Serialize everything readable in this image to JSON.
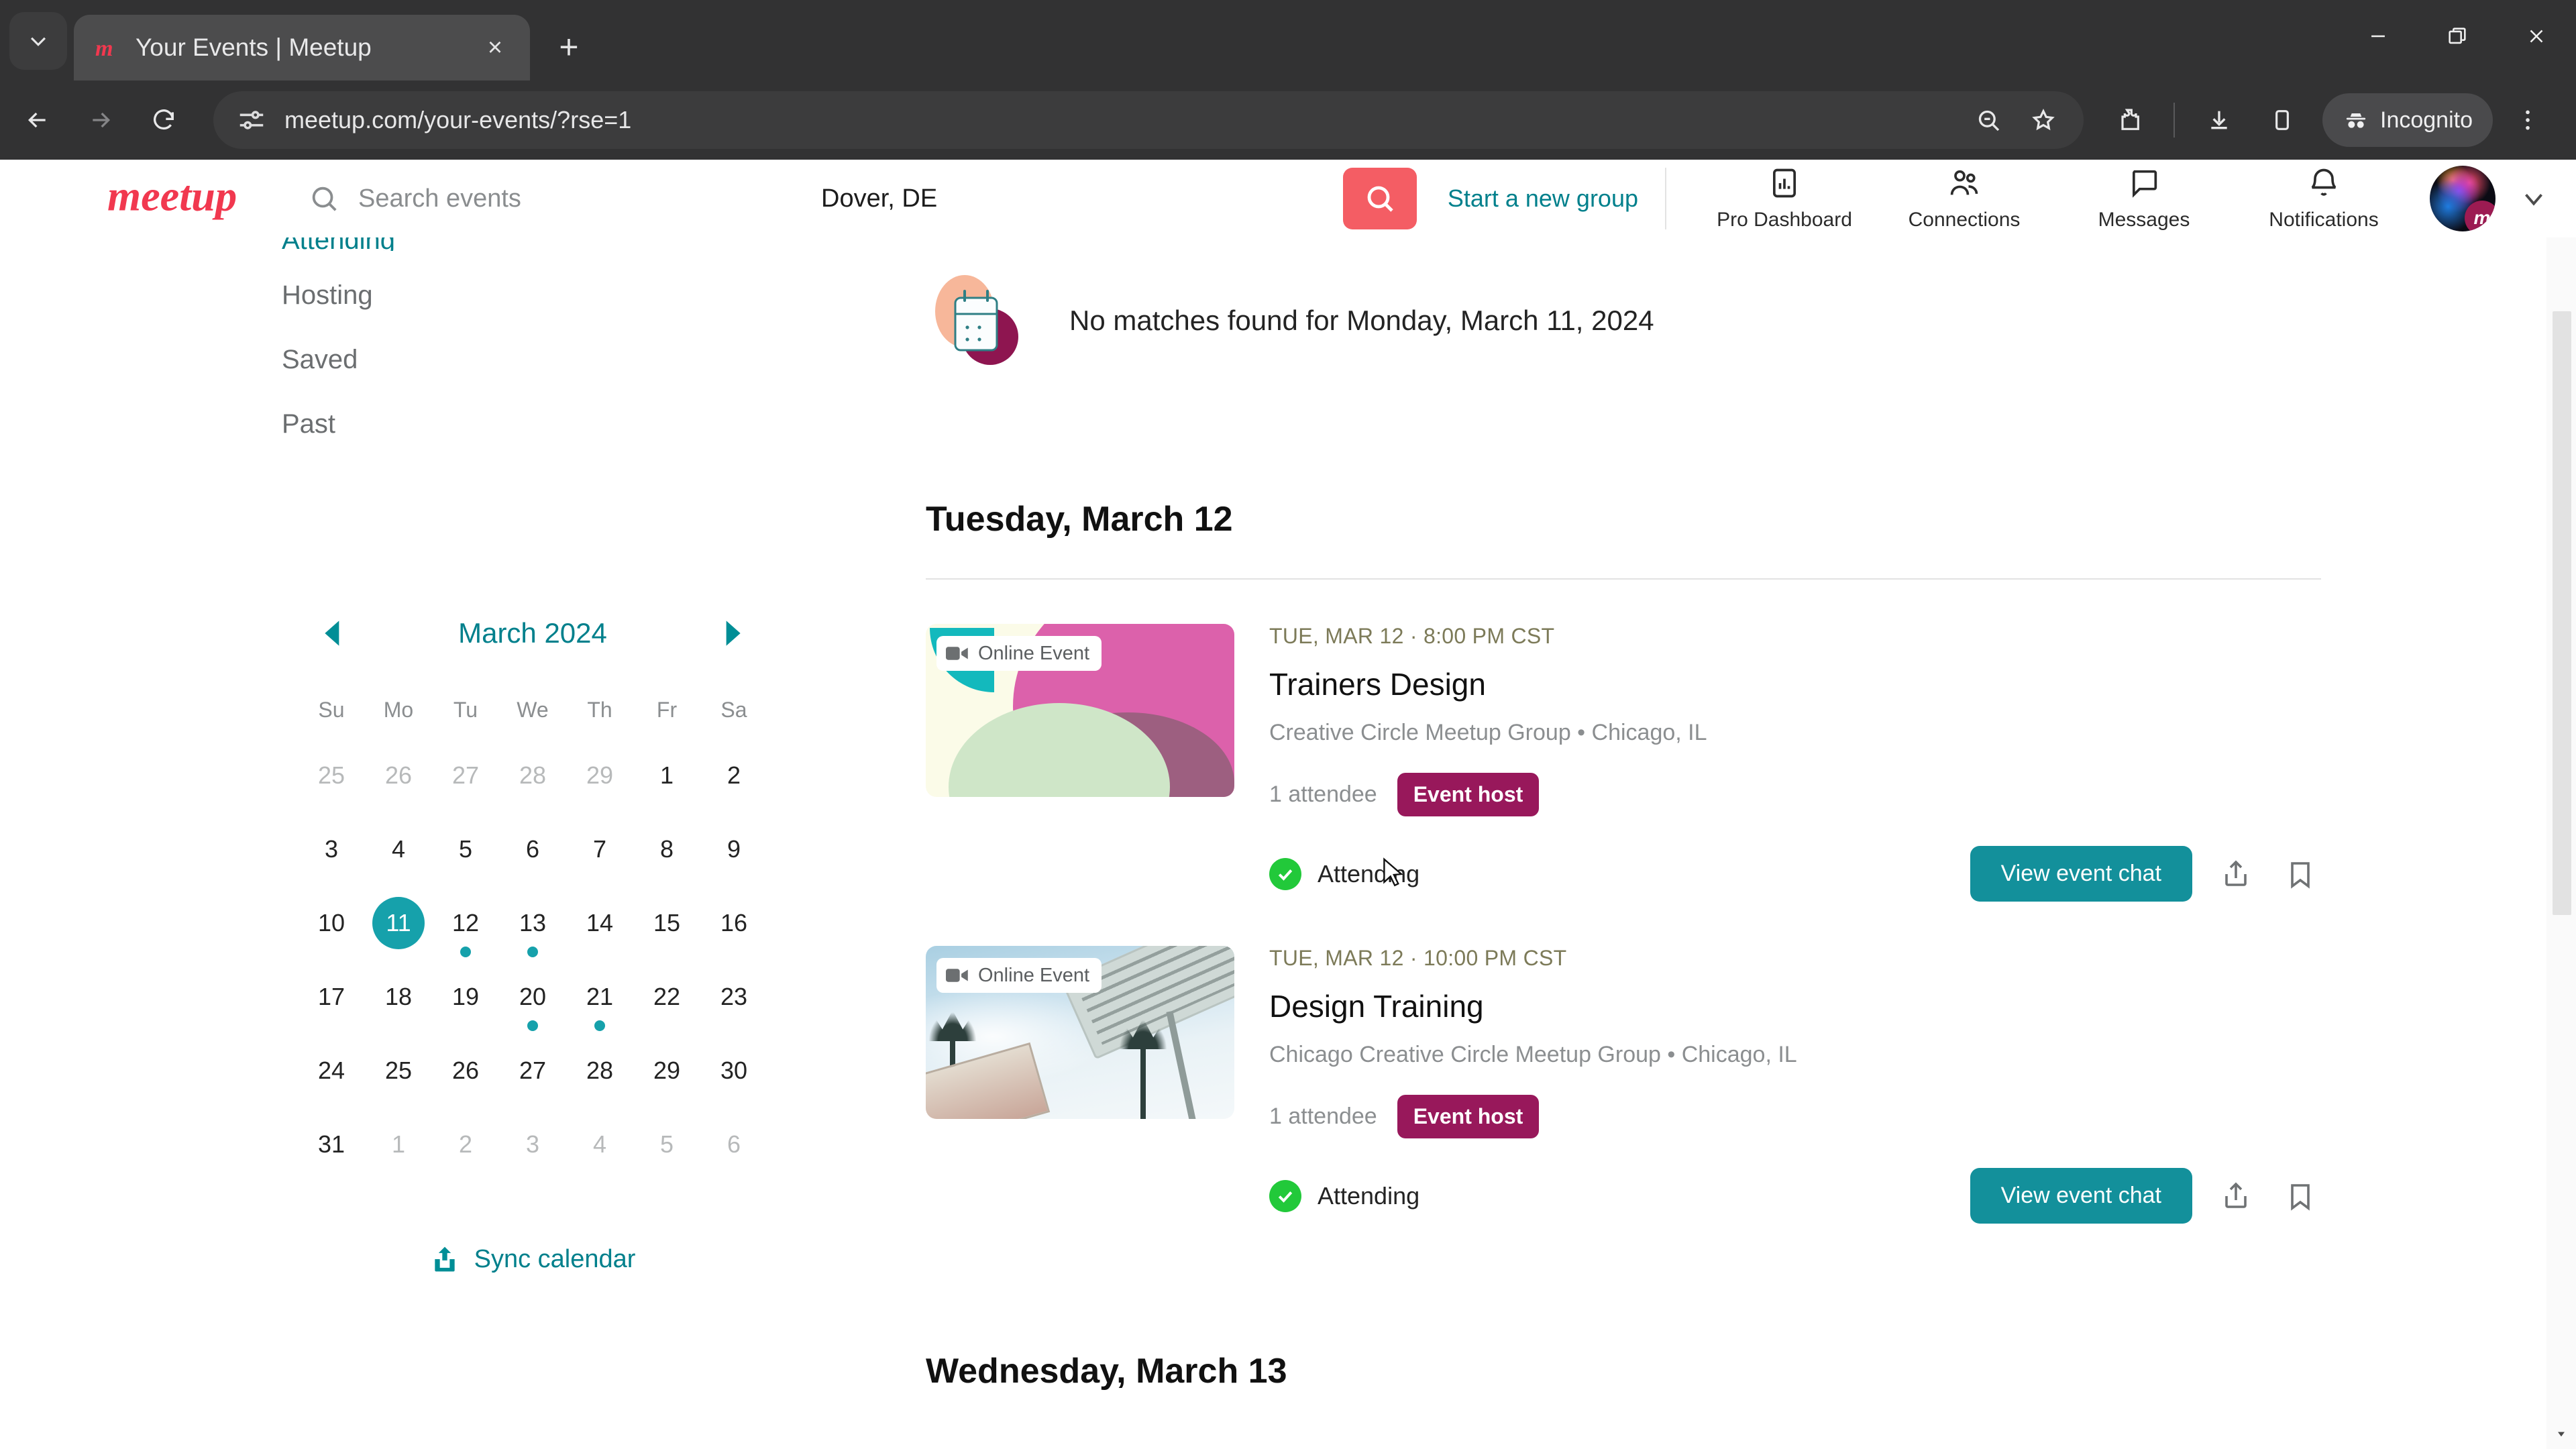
{
  "browser": {
    "tab": {
      "title": "Your Events | Meetup",
      "favicon": "meetup-m-icon",
      "close": "×"
    },
    "new_tab_label": "+",
    "omnibox": {
      "url": "meetup.com/your-events/?rse=1",
      "lead_icon": "page-settings-icon"
    },
    "toolbar_icons": [
      "back-icon",
      "forward-icon",
      "reload-icon",
      "zoom-icon",
      "bookmark-star-icon",
      "extensions-icon",
      "downloads-icon",
      "side-panel-icon",
      "more-menu-icon"
    ],
    "incognito_label": "Incognito",
    "window_controls": [
      "minimize",
      "maximize",
      "close"
    ]
  },
  "header": {
    "logo_text": "meetup",
    "search": {
      "placeholder": "Search events",
      "value": ""
    },
    "location": {
      "value": "Dover, DE",
      "placeholder": "Location"
    },
    "search_button": "search-icon",
    "start_group_link": "Start a new group",
    "nav": [
      {
        "label": "Pro Dashboard",
        "icon": "pro-dashboard-icon"
      },
      {
        "label": "Connections",
        "icon": "connections-icon"
      },
      {
        "label": "Messages",
        "icon": "messages-icon"
      },
      {
        "label": "Notifications",
        "icon": "notifications-bell-icon"
      }
    ],
    "avatar_badge": "m"
  },
  "sidebar": {
    "items": [
      {
        "label": "Attending",
        "active": true
      },
      {
        "label": "Hosting",
        "active": false
      },
      {
        "label": "Saved",
        "active": false
      },
      {
        "label": "Past",
        "active": false
      }
    ],
    "sync_calendar_label": "Sync calendar"
  },
  "calendar": {
    "title": "March 2024",
    "prev_icon": "chevron-left-icon",
    "next_icon": "chevron-right-icon",
    "dow": [
      "Su",
      "Mo",
      "Tu",
      "We",
      "Th",
      "Fr",
      "Sa"
    ],
    "selected_day": 11,
    "event_days": [
      12,
      13,
      20,
      21
    ],
    "weeks": [
      [
        {
          "d": 25,
          "muted": true
        },
        {
          "d": 26,
          "muted": true
        },
        {
          "d": 27,
          "muted": true
        },
        {
          "d": 28,
          "muted": true
        },
        {
          "d": 29,
          "muted": true
        },
        {
          "d": 1,
          "muted": false
        },
        {
          "d": 2,
          "muted": false
        }
      ],
      [
        {
          "d": 3,
          "muted": false
        },
        {
          "d": 4,
          "muted": false
        },
        {
          "d": 5,
          "muted": false
        },
        {
          "d": 6,
          "muted": false
        },
        {
          "d": 7,
          "muted": false
        },
        {
          "d": 8,
          "muted": false
        },
        {
          "d": 9,
          "muted": false
        }
      ],
      [
        {
          "d": 10,
          "muted": false
        },
        {
          "d": 11,
          "muted": false,
          "selected": true
        },
        {
          "d": 12,
          "muted": false,
          "dot": true
        },
        {
          "d": 13,
          "muted": false,
          "dot": true
        },
        {
          "d": 14,
          "muted": false
        },
        {
          "d": 15,
          "muted": false
        },
        {
          "d": 16,
          "muted": false
        }
      ],
      [
        {
          "d": 17,
          "muted": false
        },
        {
          "d": 18,
          "muted": false
        },
        {
          "d": 19,
          "muted": false
        },
        {
          "d": 20,
          "muted": false,
          "dot": true
        },
        {
          "d": 21,
          "muted": false,
          "dot": true
        },
        {
          "d": 22,
          "muted": false
        },
        {
          "d": 23,
          "muted": false
        }
      ],
      [
        {
          "d": 24,
          "muted": false
        },
        {
          "d": 25,
          "muted": false
        },
        {
          "d": 26,
          "muted": false
        },
        {
          "d": 27,
          "muted": false
        },
        {
          "d": 28,
          "muted": false
        },
        {
          "d": 29,
          "muted": false
        },
        {
          "d": 30,
          "muted": false
        }
      ],
      [
        {
          "d": 31,
          "muted": false
        },
        {
          "d": 1,
          "muted": true
        },
        {
          "d": 2,
          "muted": true
        },
        {
          "d": 3,
          "muted": true
        },
        {
          "d": 4,
          "muted": true
        },
        {
          "d": 5,
          "muted": true
        },
        {
          "d": 6,
          "muted": true
        }
      ]
    ]
  },
  "main": {
    "empty_state": {
      "text": "No matches found for Monday, March 11, 2024",
      "icon": "calendar-empty-illustration"
    },
    "day_heading": "Tuesday, March 12",
    "next_day_heading": "Wednesday, March 13",
    "events": [
      {
        "online_label": "Online Event",
        "time": "TUE, MAR 12 · 8:00 PM CST",
        "title": "Trainers Design",
        "group": "Creative Circle Meetup Group • Chicago, IL",
        "attendees": "1 attendee",
        "host_badge": "Event host",
        "attending": "Attending",
        "chat_button": "View event chat",
        "share_icon": "share-icon",
        "save_icon": "bookmark-icon"
      },
      {
        "online_label": "Online Event",
        "time": "TUE, MAR 12 · 10:00 PM CST",
        "title": "Design Training",
        "group": "Chicago Creative Circle Meetup Group • Chicago, IL",
        "attendees": "1 attendee",
        "host_badge": "Event host",
        "attending": "Attending",
        "chat_button": "View event chat",
        "share_icon": "share-icon",
        "save_icon": "bookmark-icon"
      }
    ]
  },
  "colors": {
    "brand_red": "#f1384f",
    "teal": "#00808c",
    "teal_selected": "#16a1ab",
    "magenta": "#98185b",
    "green": "#22c93a",
    "coral": "#f45d64"
  }
}
